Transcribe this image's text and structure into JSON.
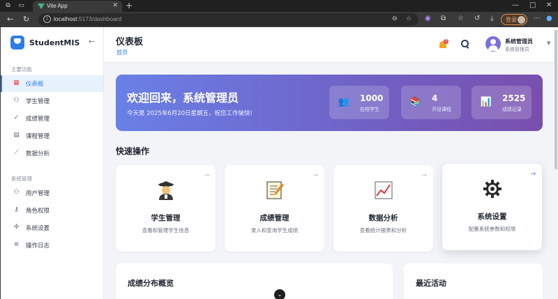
{
  "browser": {
    "tab_title": "Vite App",
    "url_host": "localhost",
    "url_path": ":5173/dashboard",
    "login_label": "登录"
  },
  "sidebar": {
    "brand": "StudentMIS",
    "sections": [
      {
        "title": "主要功能",
        "items": [
          {
            "label": "仪表板",
            "icon": "dashboard-icon",
            "active": true
          },
          {
            "label": "学生管理",
            "icon": "users-icon"
          },
          {
            "label": "成绩管理",
            "icon": "check-icon"
          },
          {
            "label": "课程管理",
            "icon": "book-icon"
          },
          {
            "label": "数据分析",
            "icon": "chart-icon"
          }
        ]
      },
      {
        "title": "系统管理",
        "items": [
          {
            "label": "用户管理",
            "icon": "user-group-icon"
          },
          {
            "label": "角色权限",
            "icon": "key-icon"
          },
          {
            "label": "系统设置",
            "icon": "settings-icon"
          },
          {
            "label": "操作日志",
            "icon": "log-icon"
          }
        ]
      }
    ]
  },
  "header": {
    "title": "仪表板",
    "breadcrumb": "首页",
    "notification_count": "3",
    "user_name": "系统管理员",
    "user_role": "系统管理员"
  },
  "banner": {
    "welcome": "欢迎回来，系统管理员",
    "subtitle": "今天是 2025年6月20日星期五，祝您工作愉快!",
    "stats": [
      {
        "value": "1000",
        "label": "在校学生",
        "icon": "students-icon"
      },
      {
        "value": "4",
        "label": "开设课程",
        "icon": "books-icon"
      },
      {
        "value": "2525",
        "label": "成绩记录",
        "icon": "bar-chart-icon"
      }
    ]
  },
  "quick_actions": {
    "heading": "快速操作",
    "cards": [
      {
        "title": "学生管理",
        "desc": "查看和管理学生信息",
        "icon": "graduate-icon"
      },
      {
        "title": "成绩管理",
        "desc": "录入和查询学生成绩",
        "icon": "memo-icon"
      },
      {
        "title": "数据分析",
        "desc": "查看统计报表和分析",
        "icon": "trend-chart-icon"
      },
      {
        "title": "系统设置",
        "desc": "配置系统参数和权限",
        "icon": "gear-icon"
      }
    ]
  },
  "panels": {
    "grade_overview": "成绩分布概览",
    "recent_activity": "最近活动"
  },
  "colors": {
    "accent": "#2d7ee8",
    "banner_start": "#6a80e6",
    "banner_end": "#7a4fae",
    "badge": "#e5484d"
  }
}
